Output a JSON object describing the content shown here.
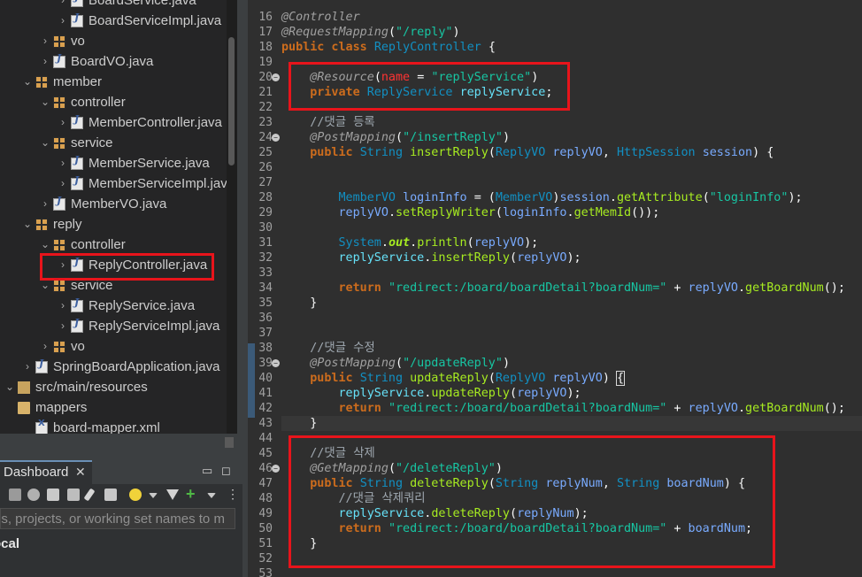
{
  "explorer": {
    "rows": [
      {
        "label": "BoardService.java",
        "type": "java",
        "indent": 3,
        "arrow": "›"
      },
      {
        "label": "BoardServiceImpl.java",
        "type": "java",
        "indent": 3,
        "arrow": "›"
      },
      {
        "label": "vo",
        "type": "package",
        "indent": 2,
        "arrow": "›"
      },
      {
        "label": "BoardVO.java",
        "type": "java",
        "indent": 2,
        "arrow": "›"
      },
      {
        "label": "member",
        "type": "package",
        "indent": 1,
        "arrow": "⌄"
      },
      {
        "label": "controller",
        "type": "package",
        "indent": 2,
        "arrow": "⌄"
      },
      {
        "label": "MemberController.java",
        "type": "java",
        "indent": 3,
        "arrow": "›"
      },
      {
        "label": "service",
        "type": "package",
        "indent": 2,
        "arrow": "⌄"
      },
      {
        "label": "MemberService.java",
        "type": "java",
        "indent": 3,
        "arrow": "›"
      },
      {
        "label": "MemberServiceImpl.java",
        "type": "java",
        "indent": 3,
        "arrow": "›"
      },
      {
        "label": "MemberVO.java",
        "type": "java",
        "indent": 2,
        "arrow": "›"
      },
      {
        "label": "reply",
        "type": "package",
        "indent": 1,
        "arrow": "⌄"
      },
      {
        "label": "controller",
        "type": "package",
        "indent": 2,
        "arrow": "⌄"
      },
      {
        "label": "ReplyController.java",
        "type": "java",
        "indent": 3,
        "arrow": "›"
      },
      {
        "label": "service",
        "type": "package",
        "indent": 2,
        "arrow": "⌄"
      },
      {
        "label": "ReplyService.java",
        "type": "java",
        "indent": 3,
        "arrow": "›"
      },
      {
        "label": "ReplyServiceImpl.java",
        "type": "java",
        "indent": 3,
        "arrow": "›"
      },
      {
        "label": "vo",
        "type": "package",
        "indent": 2,
        "arrow": "›"
      },
      {
        "label": "SpringBoardApplication.java",
        "type": "java",
        "indent": 1,
        "arrow": "›"
      },
      {
        "label": "src/main/resources",
        "type": "resources",
        "indent": 0,
        "arrow": "⌄"
      },
      {
        "label": "mappers",
        "type": "folder",
        "indent": 0,
        "arrow": ""
      },
      {
        "label": "board-mapper.xml",
        "type": "xml",
        "indent": 1,
        "arrow": ""
      }
    ]
  },
  "dashboard": {
    "tab_label": "Dashboard",
    "close_glyph": "✕",
    "search_placeholder": "gs, projects, or working set names to m",
    "section_label": "ocal"
  },
  "editor": {
    "lines": [
      {
        "n": "16",
        "fold": false,
        "html": "<span class=\"ann\">@Controller</span>"
      },
      {
        "n": "17",
        "fold": false,
        "html": "<span class=\"ann\">@RequestMapping</span><span class=\"punc\">(</span><span class=\"str\">\"/reply\"</span><span class=\"punc\">)</span>"
      },
      {
        "n": "18",
        "fold": false,
        "html": "<span class=\"kw\">public class</span> <span class=\"typ\">ReplyController</span> <span class=\"punc\">{</span>"
      },
      {
        "n": "19",
        "fold": false,
        "html": ""
      },
      {
        "n": "20",
        "fold": true,
        "html": "    <span class=\"ann\">@Resource</span><span class=\"punc\">(</span><span class=\"red\">name</span> <span class=\"punc\">=</span> <span class=\"str\">\"replyService\"</span><span class=\"punc\">)</span>"
      },
      {
        "n": "21",
        "fold": false,
        "html": "    <span class=\"kw\">private</span> <span class=\"typ\">ReplyService</span> <span class=\"fld\">replyService</span><span class=\"punc\">;</span>"
      },
      {
        "n": "22",
        "fold": false,
        "html": ""
      },
      {
        "n": "23",
        "fold": false,
        "html": "    <span class=\"cmt\">//댓글 등록</span>"
      },
      {
        "n": "24",
        "fold": true,
        "html": "    <span class=\"ann\">@PostMapping</span><span class=\"punc\">(</span><span class=\"str\">\"/insertReply\"</span><span class=\"punc\">)</span>"
      },
      {
        "n": "25",
        "fold": false,
        "html": "    <span class=\"kw\">public</span> <span class=\"typ\">String</span> <span class=\"mth\">insertReply</span><span class=\"punc\">(</span><span class=\"typ\">ReplyVO</span> <span class=\"var\">replyVO</span><span class=\"punc\">,</span> <span class=\"typ\">HttpSession</span> <span class=\"var\">session</span><span class=\"punc\">) {</span>"
      },
      {
        "n": "26",
        "fold": false,
        "html": ""
      },
      {
        "n": "27",
        "fold": false,
        "html": ""
      },
      {
        "n": "28",
        "fold": false,
        "html": "        <span class=\"typ\">MemberVO</span> <span class=\"var\">loginInfo</span> <span class=\"punc\">= (</span><span class=\"typ\">MemberVO</span><span class=\"punc\">)</span><span class=\"var\">session</span><span class=\"punc\">.</span><span class=\"mth\">getAttribute</span><span class=\"punc\">(</span><span class=\"str\">\"loginInfo\"</span><span class=\"punc\">);</span>"
      },
      {
        "n": "29",
        "fold": false,
        "html": "        <span class=\"var\">replyVO</span><span class=\"punc\">.</span><span class=\"mth\">setReplyWriter</span><span class=\"punc\">(</span><span class=\"var\">loginInfo</span><span class=\"punc\">.</span><span class=\"mth\">getMemId</span><span class=\"punc\">());</span>"
      },
      {
        "n": "30",
        "fold": false,
        "html": ""
      },
      {
        "n": "31",
        "fold": false,
        "html": "        <span class=\"typ\">System</span><span class=\"punc\">.</span><span class=\"stat\">out</span><span class=\"punc\">.</span><span class=\"mth\">println</span><span class=\"punc\">(</span><span class=\"var\">replyVO</span><span class=\"punc\">);</span>"
      },
      {
        "n": "32",
        "fold": false,
        "html": "        <span class=\"fld\">replyService</span><span class=\"punc\">.</span><span class=\"mth\">insertReply</span><span class=\"punc\">(</span><span class=\"var\">replyVO</span><span class=\"punc\">);</span>"
      },
      {
        "n": "33",
        "fold": false,
        "html": ""
      },
      {
        "n": "34",
        "fold": false,
        "html": "        <span class=\"kw\">return</span> <span class=\"str\">\"redirect:/board/boardDetail?boardNum=\"</span> <span class=\"punc\">+</span> <span class=\"var\">replyVO</span><span class=\"punc\">.</span><span class=\"mth\">getBoardNum</span><span class=\"punc\">();</span>"
      },
      {
        "n": "35",
        "fold": false,
        "html": "    <span class=\"punc\">}</span>"
      },
      {
        "n": "36",
        "fold": false,
        "html": ""
      },
      {
        "n": "37",
        "fold": false,
        "html": ""
      },
      {
        "n": "38",
        "fold": false,
        "html": "    <span class=\"cmt\">//댓글 수정</span>"
      },
      {
        "n": "39",
        "fold": true,
        "html": "    <span class=\"ann\">@PostMapping</span><span class=\"punc\">(</span><span class=\"str\">\"/updateReply\"</span><span class=\"punc\">)</span>"
      },
      {
        "n": "40",
        "fold": false,
        "html": "    <span class=\"kw\">public</span> <span class=\"typ\">String</span> <span class=\"mth\">updateReply</span><span class=\"punc\">(</span><span class=\"typ\">ReplyVO</span> <span class=\"var\">replyVO</span><span class=\"punc\">) </span><span class=\"punc cursor-box\">{</span>"
      },
      {
        "n": "41",
        "fold": false,
        "html": "        <span class=\"fld\">replyService</span><span class=\"punc\">.</span><span class=\"mth\">updateReply</span><span class=\"punc\">(</span><span class=\"var\">replyVO</span><span class=\"punc\">);</span>"
      },
      {
        "n": "42",
        "fold": false,
        "html": "        <span class=\"kw\">return</span> <span class=\"str\">\"redirect:/board/boardDetail?boardNum=\"</span> <span class=\"punc\">+</span> <span class=\"var\">replyVO</span><span class=\"punc\">.</span><span class=\"mth\">getBoardNum</span><span class=\"punc\">();</span>"
      },
      {
        "n": "43",
        "fold": false,
        "hl": true,
        "html": "    <span class=\"punc\">}</span>"
      },
      {
        "n": "44",
        "fold": false,
        "html": ""
      },
      {
        "n": "45",
        "fold": false,
        "html": "    <span class=\"cmt\">//댓글 삭제</span>"
      },
      {
        "n": "46",
        "fold": true,
        "html": "    <span class=\"ann\">@GetMapping</span><span class=\"punc\">(</span><span class=\"str\">\"/deleteReply\"</span><span class=\"punc\">)</span>"
      },
      {
        "n": "47",
        "fold": false,
        "html": "    <span class=\"kw\">public</span> <span class=\"typ\">String</span> <span class=\"mth\">deleteReply</span><span class=\"punc\">(</span><span class=\"typ\">String</span> <span class=\"var\">replyNum</span><span class=\"punc\">,</span> <span class=\"typ\">String</span> <span class=\"var\">boardNum</span><span class=\"punc\">) {</span>"
      },
      {
        "n": "48",
        "fold": false,
        "html": "        <span class=\"cmt\">//댓글 삭제쿼리</span>"
      },
      {
        "n": "49",
        "fold": false,
        "html": "        <span class=\"fld\">replyService</span><span class=\"punc\">.</span><span class=\"mth\">deleteReply</span><span class=\"punc\">(</span><span class=\"var\">replyNum</span><span class=\"punc\">);</span>"
      },
      {
        "n": "50",
        "fold": false,
        "html": "        <span class=\"kw\">return</span> <span class=\"str\">\"redirect:/board/boardDetail?boardNum=\"</span> <span class=\"punc\">+</span> <span class=\"var\">boardNum</span><span class=\"punc\">;</span>"
      },
      {
        "n": "51",
        "fold": false,
        "html": "    <span class=\"punc\">}</span>"
      },
      {
        "n": "52",
        "fold": false,
        "html": ""
      },
      {
        "n": "53",
        "fold": false,
        "html": ""
      }
    ]
  },
  "colors": {
    "highlight_box": "#e8141b",
    "editor_bg": "#2f2f2f",
    "explorer_bg": "#252526"
  }
}
